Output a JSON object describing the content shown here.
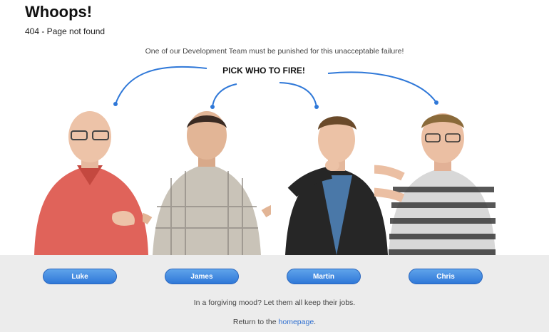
{
  "header": {
    "title": "Whoops!",
    "subtitle": "404 - Page not found"
  },
  "tagline": "One of our Development Team must be punished for this unacceptable failure!",
  "pick_label": "PICK WHO TO FIRE!",
  "people": [
    {
      "name": "Luke",
      "shirt_color": "#e0635a"
    },
    {
      "name": "James",
      "shirt_color": "#c9c3b8"
    },
    {
      "name": "Martin",
      "shirt_color": "#262626"
    },
    {
      "name": "Chris",
      "shirt_color": "#d8d8d8"
    }
  ],
  "footer": {
    "forgive_text": "In a forgiving mood? Let them all keep their jobs.",
    "return_prefix": "Return to the ",
    "return_link": "homepage",
    "return_suffix": "."
  },
  "colors": {
    "button": "#3b82e0",
    "arrow": "#2f78d8",
    "bottom_bg": "#ececec"
  }
}
